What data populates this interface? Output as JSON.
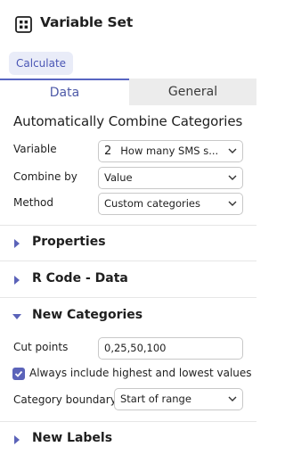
{
  "header": {
    "title": "Variable Set",
    "icon": "grid-icon"
  },
  "calculate_label": "Calculate",
  "tabs": [
    {
      "label": "Data",
      "active": true
    },
    {
      "label": "General",
      "active": false
    }
  ],
  "section_title": "Automatically Combine Categories",
  "fields": {
    "variable": {
      "label": "Variable",
      "number": "2",
      "value": "How many SMS s..."
    },
    "combine_by": {
      "label": "Combine by",
      "value": "Value"
    },
    "method": {
      "label": "Method",
      "value": "Custom categories"
    }
  },
  "collapsibles": {
    "properties": "Properties",
    "r_code": "R Code - Data",
    "new_categories": "New Categories",
    "new_labels": "New Labels"
  },
  "new_categories": {
    "cut_points_label": "Cut points",
    "cut_points_value": "0,25,50,100",
    "checkbox_label": "Always include highest and lowest values",
    "checkbox_checked": true,
    "boundary_label": "Category boundary",
    "boundary_value": "Start of range"
  },
  "colors": {
    "accent": "#5865c2",
    "tab_inactive_bg": "#ececec"
  }
}
